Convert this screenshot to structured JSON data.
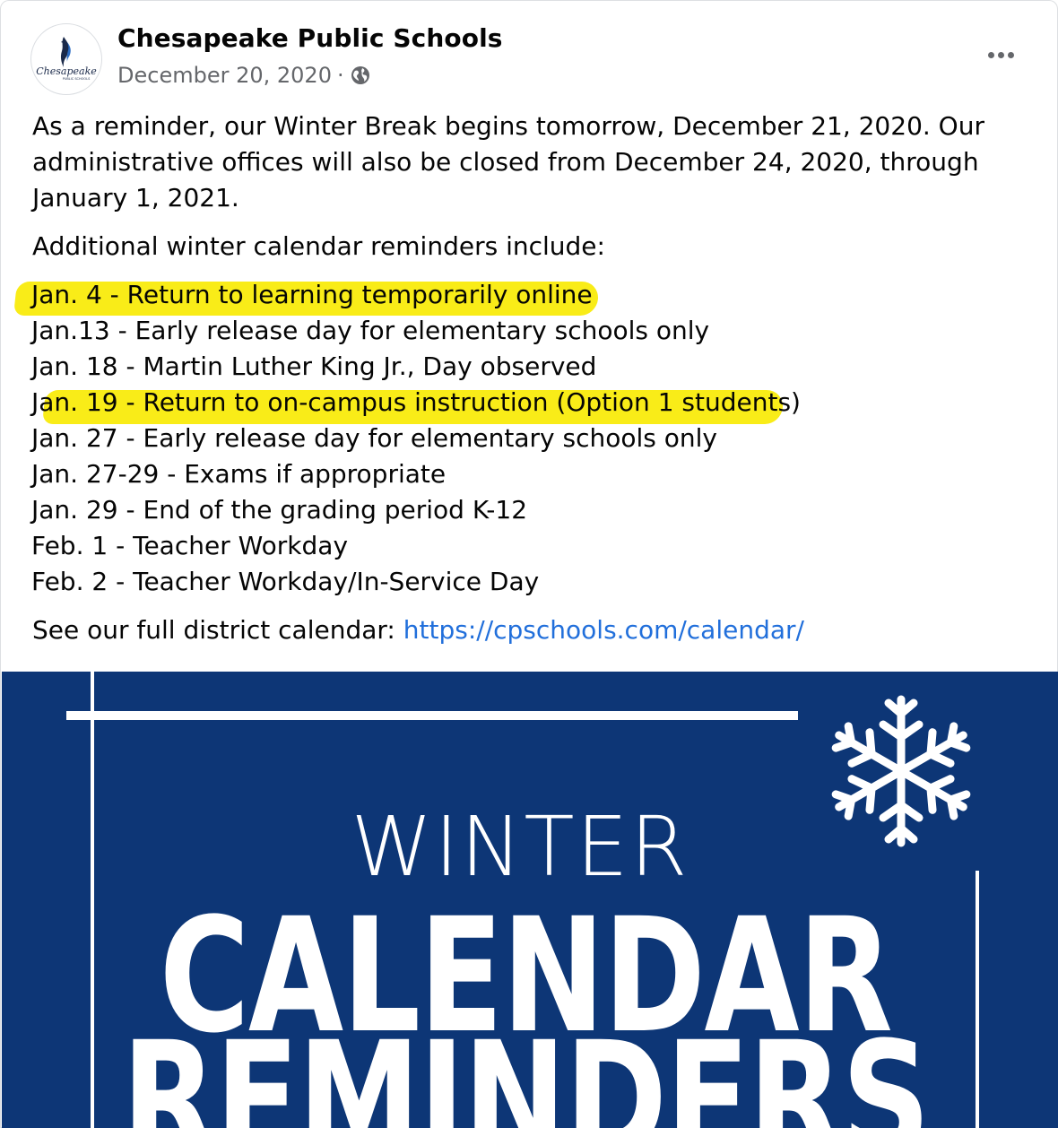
{
  "post": {
    "page_name": "Chesapeake Public Schools",
    "date": "December 20, 2020",
    "separator": "·",
    "audience_icon": "globe-icon",
    "more_icon": "more-options-icon",
    "avatar_text": "Chesapeake",
    "avatar_subtext": "PUBLIC SCHOOLS"
  },
  "body": {
    "para1": "As a reminder, our Winter Break begins tomorrow, December 21, 2020. Our administrative offices will also be closed from December 24, 2020, through January 1, 2021.",
    "para2": "Additional winter calendar reminders include:",
    "reminders": [
      {
        "text": "Jan. 4 - Return to learning temporarily online",
        "highlighted": true
      },
      {
        "text": "Jan.13 - Early release day for elementary schools only",
        "highlighted": false
      },
      {
        "text": "Jan. 18 - Martin Luther King Jr., Day observed",
        "highlighted": false
      },
      {
        "text": "Jan. 19 - Return to on-campus instruction (Option 1 students)",
        "highlighted": true
      },
      {
        "text": "Jan. 27 - Early release day for elementary schools only",
        "highlighted": false
      },
      {
        "text": "Jan. 27-29 - Exams if appropriate",
        "highlighted": false
      },
      {
        "text": "Jan. 29 - End of the grading period K-12",
        "highlighted": false
      },
      {
        "text": "Feb. 1 - Teacher Workday",
        "highlighted": false
      },
      {
        "text": "Feb. 2 - Teacher Workday/In-Service Day",
        "highlighted": false
      }
    ],
    "calendar_prefix": "See our full district calendar: ",
    "calendar_link": "https://cpschools.com/calendar/"
  },
  "graphic": {
    "line1": "WINTER",
    "line2": "CALENDAR",
    "line3": "REMINDERS",
    "background_color": "#0d3676",
    "icon": "snowflake-icon"
  },
  "colors": {
    "highlight": "#f9ec18",
    "link": "#216fdb",
    "secondary_text": "#65676b"
  }
}
